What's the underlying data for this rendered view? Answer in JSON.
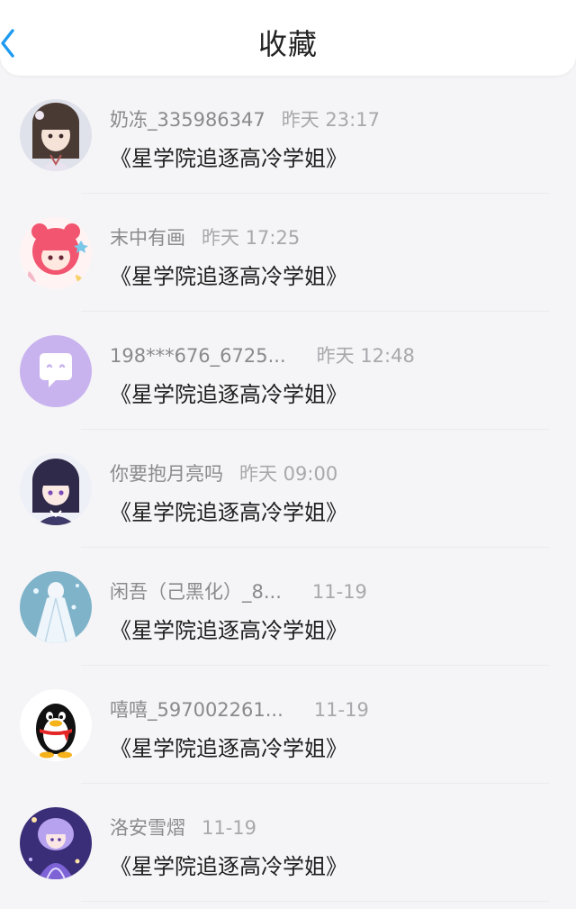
{
  "header": {
    "title": "收藏"
  },
  "favorites": [
    {
      "user": "奶冻_335986347",
      "time": "昨天 23:17",
      "novel": "《星学院追逐高冷学姐》",
      "avatar_icon": "anime-girl-brown-hair-avatar"
    },
    {
      "user": "末中有画",
      "time": "昨天 17:25",
      "novel": "《星学院追逐高冷学姐》",
      "avatar_icon": "pink-hair-chibi-avatar"
    },
    {
      "user": "198***676_6725...",
      "time": "昨天 12:48",
      "novel": "《星学院追逐高冷学姐》",
      "avatar_icon": "purple-chat-bubble-avatar"
    },
    {
      "user": "你要抱月亮吗",
      "time": "昨天 09:00",
      "novel": "《星学院追逐高冷学姐》",
      "avatar_icon": "anime-girl-dark-hair-avatar"
    },
    {
      "user": "闲吾（己黑化）_8...",
      "time": "11-19",
      "novel": "《星学院追逐高冷学姐》",
      "avatar_icon": "white-dress-fantasy-avatar"
    },
    {
      "user": "嘻嘻_597002261...",
      "time": "11-19",
      "novel": "《星学院追逐高冷学姐》",
      "avatar_icon": "qq-penguin-avatar"
    },
    {
      "user": "洛安雪熠",
      "time": "11-19",
      "novel": "《星学院追逐高冷学姐》",
      "avatar_icon": "purple-fantasy-girl-avatar"
    }
  ],
  "colors": {
    "accent": "#1e9bf0",
    "background": "#f5f5f7",
    "header_bg": "#ffffff",
    "chat_avatar_bg": "#c9b3ef"
  }
}
